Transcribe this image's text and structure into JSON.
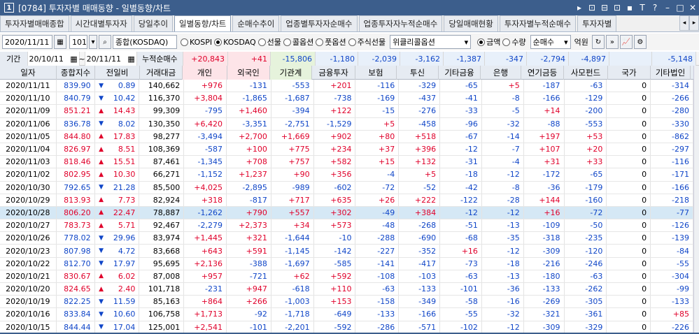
{
  "window": {
    "num": "1",
    "title": "[0784] 투자자별 매매동향 - 일별동향/차트",
    "buttons": [
      "▸",
      "⊡",
      "⊟",
      "⊡",
      "▪",
      "T",
      "?",
      "–",
      "□",
      "✕"
    ]
  },
  "tabs": [
    "투자자별매매종합",
    "시간대별투자자",
    "당일추이",
    "일별동향/차트",
    "순매수추이",
    "업종별투자자순매수",
    "업종투자자누적순매수",
    "당일매매현황",
    "투자자별누적순매수",
    "투자자별"
  ],
  "active_tab": 3,
  "toolbar": {
    "date": "2020/11/11",
    "code": "101",
    "search_text": "종합(KOSDAQ)",
    "radios": [
      {
        "label": "KOSPI",
        "on": false
      },
      {
        "label": "KOSDAQ",
        "on": true
      },
      {
        "label": "선물",
        "on": false
      },
      {
        "label": "콜옵션",
        "on": false
      },
      {
        "label": "풋옵션",
        "on": false
      },
      {
        "label": "주식선물",
        "on": false
      }
    ],
    "dropdown": "위클리콜옵션",
    "amount_radios": [
      {
        "label": "금액",
        "on": true
      },
      {
        "label": "수량",
        "on": false
      }
    ],
    "mode": "순매수",
    "unit": "억원"
  },
  "period": {
    "label": "기간",
    "from": "20/10/11",
    "to": "20/11/11",
    "cum_label": "누적순매수"
  },
  "sums": [
    "+20,843",
    "+41",
    "-15,806",
    "-1,180",
    "-2,039",
    "-3,162",
    "-1,387",
    "-347",
    "-2,794",
    "-4,897",
    "",
    "-5,148"
  ],
  "headers": [
    "일자",
    "종합지수",
    "전일비",
    "거래대금",
    "개인",
    "외국인",
    "기관계",
    "금융투자",
    "보험",
    "투신",
    "기타금융",
    "은행",
    "연기금등",
    "사모펀드",
    "국가",
    "기타법인"
  ],
  "rows": [
    [
      "2020/11/11",
      "839.90",
      "▼",
      "0.89",
      "140,662",
      "+976",
      "-131",
      "-553",
      "+201",
      "-116",
      "-329",
      "-65",
      "+5",
      "-187",
      "-63",
      "0",
      "-314"
    ],
    [
      "2020/11/10",
      "840.79",
      "▼",
      "10.42",
      "116,370",
      "+3,804",
      "-1,865",
      "-1,687",
      "-738",
      "-169",
      "-437",
      "-41",
      "-8",
      "-166",
      "-129",
      "0",
      "-266"
    ],
    [
      "2020/11/09",
      "851.21",
      "▲",
      "14.43",
      "99,309",
      "-795",
      "+1,460",
      "-394",
      "+122",
      "-15",
      "-276",
      "-33",
      "-5",
      "+14",
      "-200",
      "0",
      "-280"
    ],
    [
      "2020/11/06",
      "836.78",
      "▼",
      "8.02",
      "130,350",
      "+6,420",
      "-3,351",
      "-2,751",
      "-1,529",
      "+5",
      "-458",
      "-96",
      "-32",
      "-88",
      "-553",
      "0",
      "-330"
    ],
    [
      "2020/11/05",
      "844.80",
      "▲",
      "17.83",
      "98,277",
      "-3,494",
      "+2,700",
      "+1,669",
      "+902",
      "+80",
      "+518",
      "-67",
      "-14",
      "+197",
      "+53",
      "0",
      "-862"
    ],
    [
      "2020/11/04",
      "826.97",
      "▲",
      "8.51",
      "108,369",
      "-587",
      "+100",
      "+775",
      "+234",
      "+37",
      "+396",
      "-12",
      "-7",
      "+107",
      "+20",
      "0",
      "-297"
    ],
    [
      "2020/11/03",
      "818.46",
      "▲",
      "15.51",
      "87,461",
      "-1,345",
      "+708",
      "+757",
      "+582",
      "+15",
      "+132",
      "-31",
      "-4",
      "+31",
      "+33",
      "0",
      "-116"
    ],
    [
      "2020/11/02",
      "802.95",
      "▲",
      "10.30",
      "66,271",
      "-1,152",
      "+1,237",
      "+90",
      "+356",
      "-4",
      "+5",
      "-18",
      "-12",
      "-172",
      "-65",
      "0",
      "-171"
    ],
    [
      "2020/10/30",
      "792.65",
      "▼",
      "21.28",
      "85,500",
      "+4,025",
      "-2,895",
      "-989",
      "-602",
      "-72",
      "-52",
      "-42",
      "-8",
      "-36",
      "-179",
      "0",
      "-166"
    ],
    [
      "2020/10/29",
      "813.93",
      "▲",
      "7.73",
      "82,924",
      "+318",
      "-817",
      "+717",
      "+635",
      "+26",
      "+222",
      "-122",
      "-28",
      "+144",
      "-160",
      "0",
      "-218"
    ],
    [
      "2020/10/28",
      "806.20",
      "▲",
      "22.47",
      "78,887",
      "-1,262",
      "+790",
      "+557",
      "+302",
      "-49",
      "+384",
      "-12",
      "-12",
      "+16",
      "-72",
      "0",
      "-77"
    ],
    [
      "2020/10/27",
      "783.73",
      "▲",
      "5.71",
      "92,467",
      "-2,279",
      "+2,373",
      "+34",
      "+573",
      "-48",
      "-268",
      "-51",
      "-13",
      "-109",
      "-50",
      "0",
      "-126"
    ],
    [
      "2020/10/26",
      "778.02",
      "▼",
      "29.96",
      "83,974",
      "+1,445",
      "+321",
      "-1,644",
      "-10",
      "-288",
      "-690",
      "-68",
      "-35",
      "-318",
      "-235",
      "0",
      "-139"
    ],
    [
      "2020/10/23",
      "807.98",
      "▼",
      "4.72",
      "83,668",
      "+643",
      "+591",
      "-1,145",
      "-142",
      "-227",
      "-352",
      "+16",
      "-12",
      "-309",
      "-120",
      "0",
      "-84"
    ],
    [
      "2020/10/22",
      "812.70",
      "▼",
      "17.97",
      "95,695",
      "+2,136",
      "-388",
      "-1,697",
      "-585",
      "-141",
      "-417",
      "-73",
      "-18",
      "-216",
      "-246",
      "0",
      "-55"
    ],
    [
      "2020/10/21",
      "830.67",
      "▲",
      "6.02",
      "87,008",
      "+957",
      "-721",
      "+62",
      "+592",
      "-108",
      "-103",
      "-63",
      "-13",
      "-180",
      "-63",
      "0",
      "-304"
    ],
    [
      "2020/10/20",
      "824.65",
      "▲",
      "2.40",
      "101,718",
      "-231",
      "+947",
      "-618",
      "+110",
      "-63",
      "-133",
      "-101",
      "-36",
      "-133",
      "-262",
      "0",
      "-99"
    ],
    [
      "2020/10/19",
      "822.25",
      "▼",
      "11.59",
      "85,163",
      "+864",
      "+266",
      "-1,003",
      "+153",
      "-158",
      "-349",
      "-58",
      "-16",
      "-269",
      "-305",
      "0",
      "-133"
    ],
    [
      "2020/10/16",
      "833.84",
      "▼",
      "10.60",
      "106,758",
      "+1,713",
      "-92",
      "-1,718",
      "-649",
      "-133",
      "-166",
      "-55",
      "-32",
      "-321",
      "-361",
      "0",
      "+85"
    ],
    [
      "2020/10/15",
      "844.44",
      "▼",
      "17.04",
      "125,001",
      "+2,541",
      "-101",
      "-2,201",
      "-592",
      "-286",
      "-571",
      "-102",
      "-12",
      "-309",
      "-329",
      "0",
      "-226"
    ]
  ],
  "selected_row": 10,
  "colors": {
    "red": "#e0002a",
    "blue": "#1046c8",
    "title_bg": "#3c5e8c",
    "selected": "#d5e8f5",
    "indiv_hdr": "#fde4e8",
    "foreign_hdr": "#fde4e8",
    "inst_hdr": "#e6f3dc"
  }
}
